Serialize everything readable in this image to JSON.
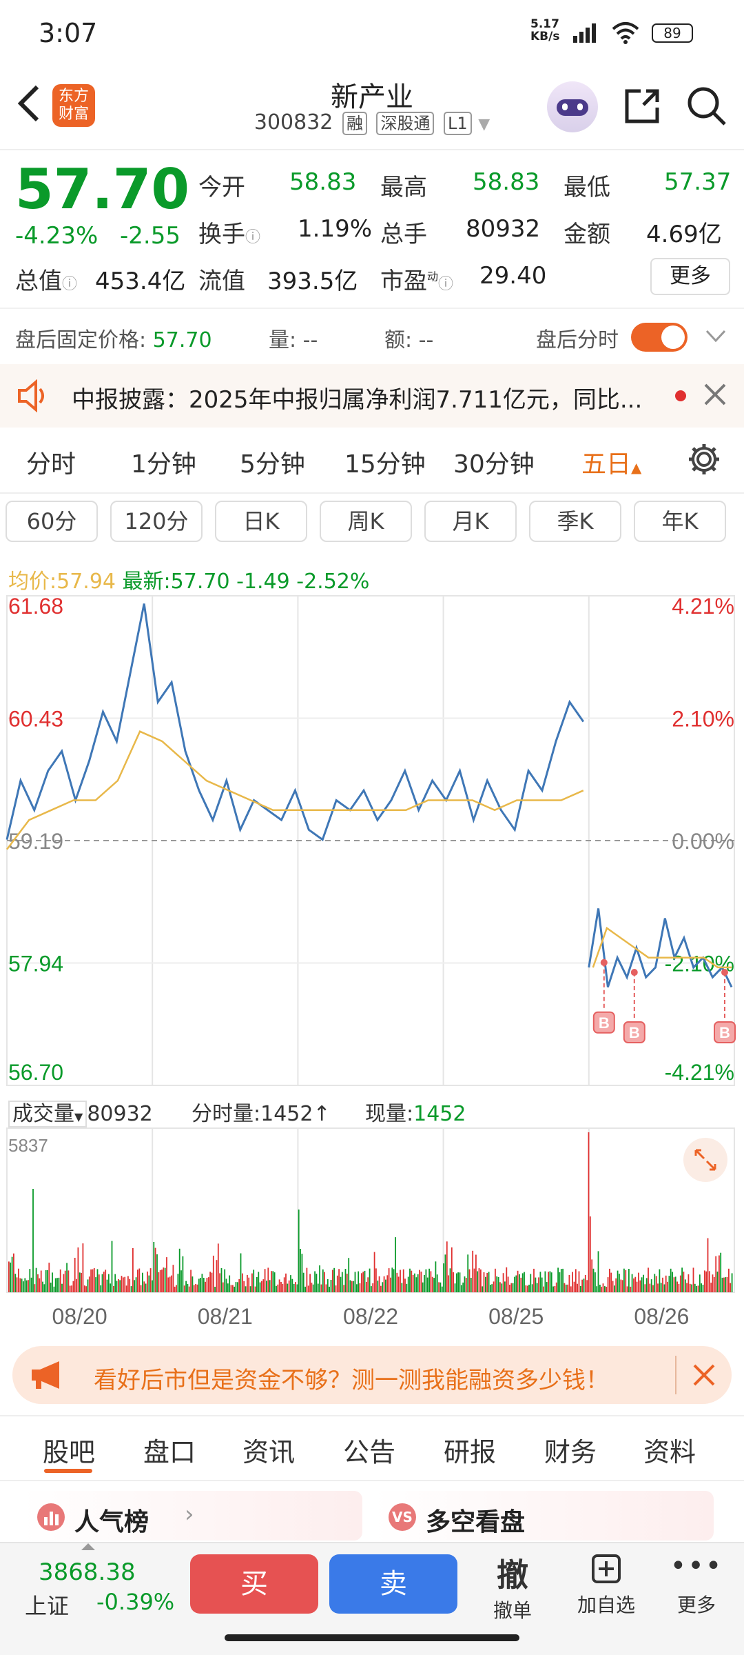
{
  "status_bar": {
    "time": "3:07",
    "net_speed": "5.17\nKB/s",
    "battery": "89"
  },
  "header": {
    "title": "新产业",
    "code": "300832",
    "tags": [
      "融",
      "深股通",
      "L1"
    ],
    "logo_text": "东方财富"
  },
  "quote": {
    "price": "57.70",
    "change_pct": "-4.23%",
    "change": "-2.55",
    "open_label": "今开",
    "open": "58.83",
    "high_label": "最高",
    "high": "58.83",
    "low_label": "最低",
    "low": "57.37",
    "turnover_label": "换手",
    "turnover": "1.19%",
    "volume_label": "总手",
    "volume": "80932",
    "amount_label": "金额",
    "amount": "4.69亿",
    "mktcap_label": "总值",
    "mktcap": "453.4亿",
    "float_label": "流值",
    "float": "393.5亿",
    "pe_label": "市盈",
    "pe_sup": "动",
    "pe": "29.40",
    "more": "更多"
  },
  "after_hours": {
    "label": "盘后固定价格:",
    "price": "57.70",
    "vol_label": "量:",
    "vol": "--",
    "amt_label": "额:",
    "amt": "--",
    "toggle_label": "盘后分时",
    "toggle_on": true
  },
  "notice": {
    "text": "中报披露：2025年中报归属净利润7.711亿元，同比..."
  },
  "period_tabs": [
    "分时",
    "1分钟",
    "5分钟",
    "15分钟",
    "30分钟",
    "五日"
  ],
  "active_period": "五日",
  "kline_chips": [
    "60分",
    "120分",
    "日K",
    "周K",
    "月K",
    "季K",
    "年K"
  ],
  "legend": {
    "avg_label": "均价:",
    "avg": "57.94",
    "last_label": "最新:",
    "last": "57.70",
    "chg": "-1.49",
    "chg_pct": "-2.52%"
  },
  "chart_data": {
    "type": "line",
    "x": [
      "08/20",
      "08/21",
      "08/22",
      "08/25",
      "08/26"
    ],
    "y_left_ticks": [
      "61.68",
      "60.43",
      "59.19",
      "57.94",
      "56.70"
    ],
    "y_right_ticks": [
      "4.21%",
      "2.10%",
      "0.00%",
      "-2.10%",
      "-4.21%"
    ],
    "ylim": [
      56.7,
      61.68
    ],
    "prev_close": 59.19,
    "series": [
      {
        "values": [
          59.2,
          59.8,
          59.5,
          59.9,
          60.1,
          59.6,
          60.0,
          60.5,
          60.2,
          60.9,
          61.6,
          60.6,
          60.8,
          60.1,
          59.7,
          59.4,
          59.8,
          59.3,
          59.6,
          59.5,
          59.4,
          59.7,
          59.3,
          59.2,
          59.6,
          59.5,
          59.7,
          59.4,
          59.6,
          59.9,
          59.5,
          59.8,
          59.6,
          59.9,
          59.4,
          59.8,
          59.5,
          59.3,
          59.9,
          59.7,
          60.2,
          60.6,
          60.4
        ]
      },
      {
        "values": [
          59.1,
          59.4,
          59.5,
          59.6,
          59.6,
          59.8,
          60.3,
          60.2,
          60.0,
          59.8,
          59.7,
          59.6,
          59.5,
          59.5,
          59.5,
          59.5,
          59.5,
          59.5,
          59.5,
          59.6,
          59.6,
          59.6,
          59.5,
          59.6,
          59.6,
          59.6,
          59.7
        ]
      },
      {
        "values": [
          57.9,
          58.5,
          57.7,
          58.0,
          57.8,
          58.1,
          57.8,
          57.9,
          58.4,
          58.0,
          58.2,
          57.9,
          58.0,
          57.8,
          57.9,
          57.7
        ]
      },
      {
        "values": [
          57.9,
          58.3,
          58.2,
          58.1,
          58.0,
          58.0,
          58.0,
          58.0,
          58.0,
          57.9,
          57.9
        ]
      }
    ],
    "volume": {
      "label": "成交量",
      "total": "80932",
      "tick_label_text": "分时量:1452↑",
      "now_label": "现量:",
      "now": "1452",
      "max": "5837"
    },
    "markers": [
      "B",
      "B",
      "B"
    ]
  },
  "promo": {
    "text": "看好后市但是资金不够？测一测我能融资多少钱！"
  },
  "section_tabs": [
    "股吧",
    "盘口",
    "资讯",
    "公告",
    "研报",
    "财务",
    "资料"
  ],
  "active_section": "股吧",
  "cards": [
    {
      "label": "人气榜"
    },
    {
      "label": "多空看盘"
    }
  ],
  "bottom": {
    "index_value": "3868.38",
    "index_name": "上证",
    "index_chg": "-0.39%",
    "buy": "买",
    "sell": "卖",
    "cancel_icon": "撤",
    "cancel": "撤单",
    "add": "加自选",
    "more": "更多"
  },
  "colors": {
    "up": "#e03030",
    "down": "#0a9a2a",
    "accent": "#e8701a",
    "line": "#3f77b6",
    "avg": "#e8b84a"
  }
}
